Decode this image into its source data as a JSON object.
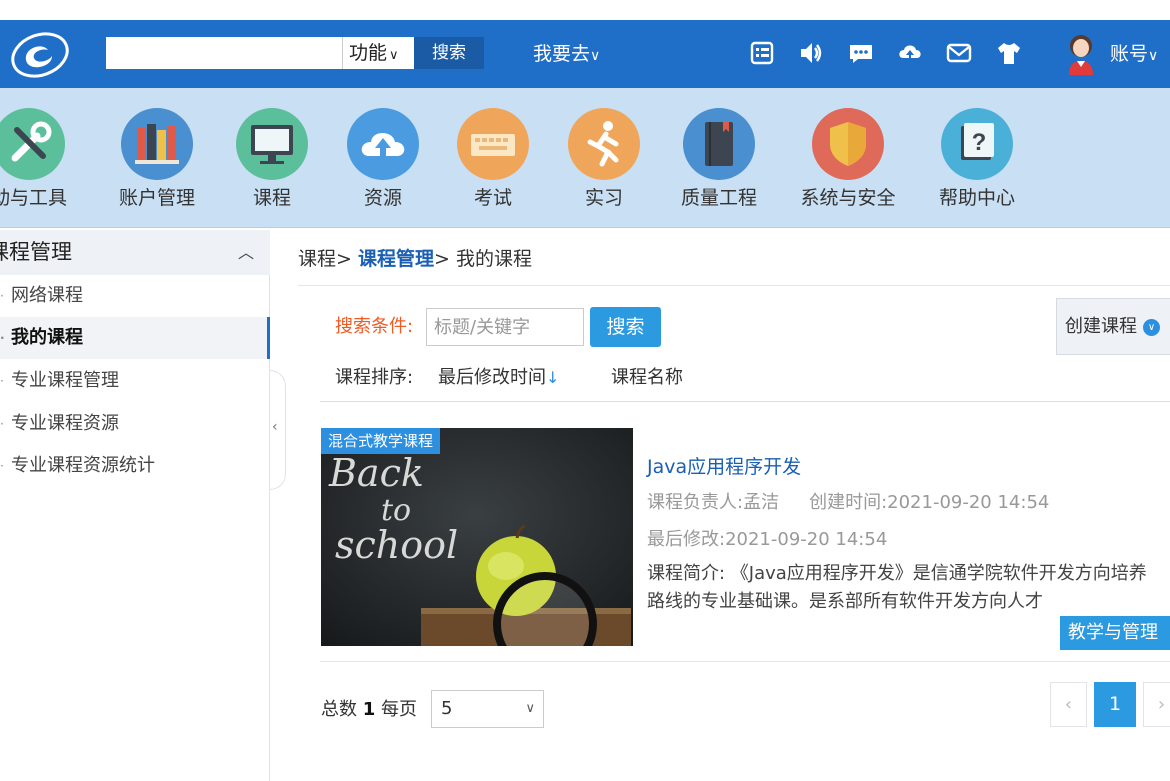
{
  "header": {
    "search_value": "",
    "func_label": "功能",
    "search_button": "搜索",
    "goto_label": "我要去",
    "account_label": "账号",
    "icons": [
      "list-icon",
      "speaker-icon",
      "chat-icon",
      "cloud-upload-icon",
      "mail-icon",
      "tshirt-icon"
    ]
  },
  "categories": [
    {
      "label": "动与工具",
      "icon": "tools-icon",
      "color": "#5bbf9b"
    },
    {
      "label": "账户管理",
      "icon": "books-icon",
      "color": "#4a8fd0"
    },
    {
      "label": "课程",
      "icon": "monitor-icon",
      "color": "#5bbf9b"
    },
    {
      "label": "资源",
      "icon": "cloud-icon",
      "color": "#4a9be0"
    },
    {
      "label": "考试",
      "icon": "keyboard-icon",
      "color": "#f0a65a"
    },
    {
      "label": "实习",
      "icon": "runner-icon",
      "color": "#f0a65a"
    },
    {
      "label": "质量工程",
      "icon": "book-icon",
      "color": "#4a8fd0"
    },
    {
      "label": "系统与安全",
      "icon": "shield-icon",
      "color": "#e06a5a"
    },
    {
      "label": "帮助中心",
      "icon": "help-icon",
      "color": "#4ab0d8"
    }
  ],
  "sidebar": {
    "title": "课程管理",
    "items": [
      {
        "label": "网络课程"
      },
      {
        "label": "我的课程"
      },
      {
        "label": "专业课程管理"
      },
      {
        "label": "专业课程资源"
      },
      {
        "label": "专业课程资源统计"
      }
    ]
  },
  "breadcrumb": {
    "root": "课程",
    "sep1": "> ",
    "middle": "课程管理",
    "sep2": "> ",
    "current": "我的课程"
  },
  "filter": {
    "condition_label": "搜索条件:",
    "keyword_placeholder": "标题/关键字",
    "search_button": "搜索",
    "create_button": "创建课程",
    "sort_label": "课程排序:",
    "sort_time": "最后修改时间",
    "sort_name": "课程名称"
  },
  "course": {
    "badge": "混合式教学课程",
    "title": "Java应用程序开发",
    "owner": "课程负责人:孟洁",
    "created": "创建时间:2021-09-20 14:54",
    "modified": "最后修改:2021-09-20 14:54",
    "intro": "课程简介: 《Java应用程序开发》是信通学院软件开发方向培养路线的专业基础课。是系部所有软件开发方向人才",
    "manage_button": "教学与管理",
    "thumb_text": [
      "Back",
      "to",
      "school"
    ]
  },
  "pagination": {
    "total_prefix": "总数",
    "total": "1",
    "per_page_label": "每页",
    "per_page": "5",
    "page": "1",
    "prev": "‹",
    "next": "›"
  }
}
